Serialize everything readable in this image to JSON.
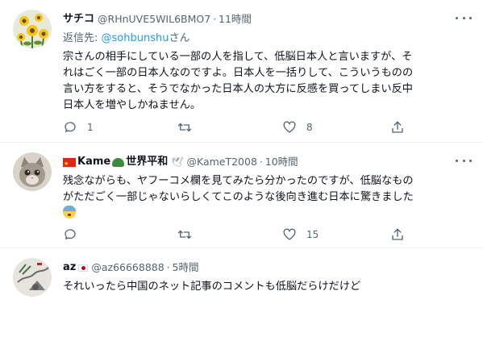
{
  "tweets": [
    {
      "display_name": "サチコ",
      "handle": "@RHnUVE5WIL6BMO7",
      "separator": "·",
      "time": "11時間",
      "reply_prefix": "返信先: ",
      "reply_mention": "@sohbunshu",
      "reply_suffix": "さん",
      "text_lines": [
        "宗さんの相手にしている一部の人を指して、低脳日本人と言いますが、そ",
        "れはごく一部の日本人なのですよ。日本人を一括りして、こういうものの",
        "言い方をすると、そうでなかった日本人の大方に反感を買ってしまい反中",
        "日本人を増やしかねません。"
      ],
      "reply_count": "1",
      "retweet_count": "",
      "like_count": "8",
      "avatar_icon": "sunflower-avatar"
    },
    {
      "display_name_part1": "Kame",
      "display_name_part2": "世界平和",
      "handle": "@KameT2008",
      "separator": "·",
      "time": "10時間",
      "text_lines": [
        "残念ながらも、ヤフーコメ欄を見てみたら分かったのですが、低脳なもの",
        "がただごく一部じゃないらしくてこのような後向き進む日本に驚きました"
      ],
      "reply_count": "",
      "retweet_count": "",
      "like_count": "15",
      "avatar_icon": "cat-avatar",
      "dove": "🕊"
    },
    {
      "display_name": "az",
      "handle": "@az66668888",
      "separator": "·",
      "time": "5時間",
      "text_lines": [
        "それいったら中国のネット記事のコメントも低脳だらけだけど"
      ],
      "avatar_icon": "ink-painting-avatar"
    }
  ],
  "colors": {
    "text": "#0f1419",
    "secondary": "#536471",
    "link": "#1d9bf0",
    "divider": "#eff3f4"
  }
}
